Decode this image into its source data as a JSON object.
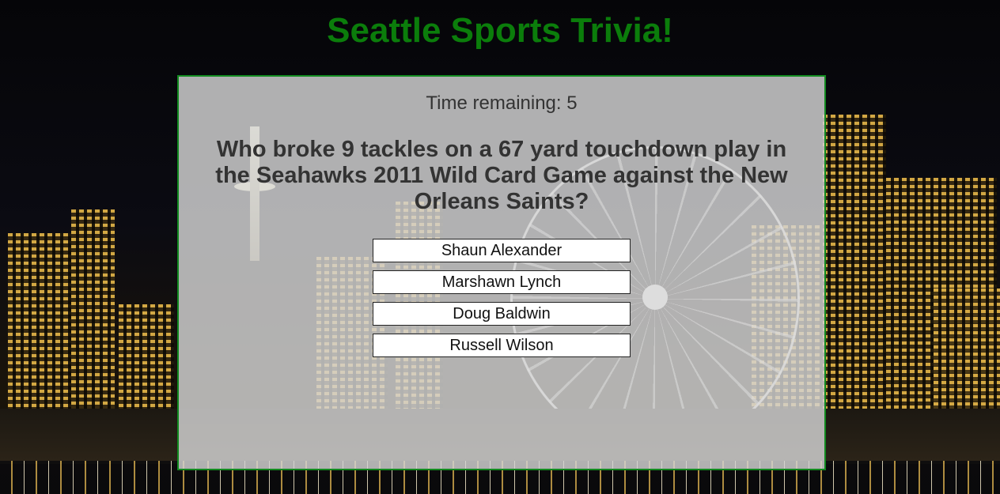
{
  "page": {
    "title": "Seattle Sports Trivia!",
    "title_color": "#0b7d0b"
  },
  "quiz": {
    "timer_text": "Time remaining: 5",
    "question": "Who broke 9 tackles on a 67 yard touchdown play in the Seahawks 2011 Wild Card Game against the New Orleans Saints?",
    "answers": [
      "Shaun Alexander",
      "Marshawn Lynch",
      "Doug Baldwin",
      "Russell Wilson"
    ],
    "panel_border_color": "#118a1f"
  },
  "background": {
    "description_icon": "seattle-skyline-night-image"
  }
}
